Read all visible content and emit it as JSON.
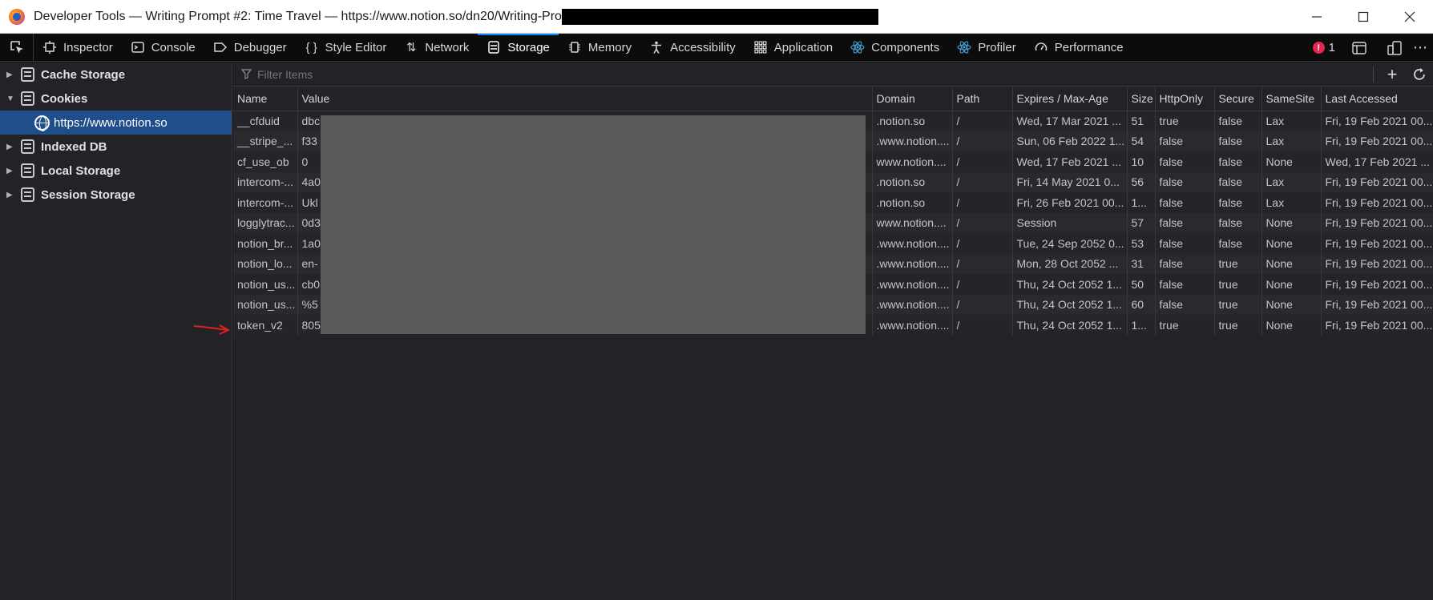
{
  "window": {
    "title": "Developer Tools — Writing Prompt #2: Time Travel — https://www.notion.so/dn20/Writing-Pro",
    "controls": [
      "minimize",
      "maximize",
      "close"
    ]
  },
  "toolbar": {
    "tabs": [
      {
        "label": "Inspector",
        "icon": "inspector-icon"
      },
      {
        "label": "Console",
        "icon": "console-icon"
      },
      {
        "label": "Debugger",
        "icon": "debugger-icon"
      },
      {
        "label": "Style Editor",
        "icon": "style-editor-icon"
      },
      {
        "label": "Network",
        "icon": "network-icon"
      },
      {
        "label": "Storage",
        "icon": "storage-icon",
        "active": true
      },
      {
        "label": "Memory",
        "icon": "memory-icon"
      },
      {
        "label": "Accessibility",
        "icon": "accessibility-icon"
      },
      {
        "label": "Application",
        "icon": "application-icon"
      },
      {
        "label": "Components",
        "icon": "react-icon"
      },
      {
        "label": "Profiler",
        "icon": "react-icon"
      },
      {
        "label": "Performance",
        "icon": "performance-icon"
      }
    ],
    "error_count": "1"
  },
  "sidebar": {
    "items": [
      {
        "label": "Cache Storage",
        "expanded": false
      },
      {
        "label": "Cookies",
        "expanded": true
      },
      {
        "label": "Indexed DB",
        "expanded": false
      },
      {
        "label": "Local Storage",
        "expanded": false
      },
      {
        "label": "Session Storage",
        "expanded": false
      }
    ],
    "cookies_child": "https://www.notion.so"
  },
  "filter": {
    "placeholder": "Filter Items"
  },
  "table": {
    "columns": [
      "Name",
      "Value",
      "Domain",
      "Path",
      "Expires / Max-Age",
      "Size",
      "HttpOnly",
      "Secure",
      "SameSite",
      "Last Accessed"
    ],
    "rows": [
      [
        "__cfduid",
        "dbc",
        ".notion.so",
        "/",
        "Wed, 17 Mar 2021 ...",
        "51",
        "true",
        "false",
        "Lax",
        "Fri, 19 Feb 2021 00..."
      ],
      [
        "__stripe_...",
        "f33",
        ".www.notion....",
        "/",
        "Sun, 06 Feb 2022 1...",
        "54",
        "false",
        "false",
        "Lax",
        "Fri, 19 Feb 2021 00..."
      ],
      [
        "cf_use_ob",
        "0",
        "www.notion....",
        "/",
        "Wed, 17 Feb 2021 ...",
        "10",
        "false",
        "false",
        "None",
        "Wed, 17 Feb 2021 ..."
      ],
      [
        "intercom-...",
        "4a0",
        ".notion.so",
        "/",
        "Fri, 14 May 2021 0...",
        "56",
        "false",
        "false",
        "Lax",
        "Fri, 19 Feb 2021 00..."
      ],
      [
        "intercom-...",
        "Ukl",
        ".notion.so",
        "/",
        "Fri, 26 Feb 2021 00...",
        "1...",
        "false",
        "false",
        "Lax",
        "Fri, 19 Feb 2021 00..."
      ],
      [
        "logglytrac...",
        "0d3",
        "www.notion....",
        "/",
        "Session",
        "57",
        "false",
        "false",
        "None",
        "Fri, 19 Feb 2021 00..."
      ],
      [
        "notion_br...",
        "1a0",
        ".www.notion....",
        "/",
        "Tue, 24 Sep 2052 0...",
        "53",
        "false",
        "false",
        "None",
        "Fri, 19 Feb 2021 00..."
      ],
      [
        "notion_lo...",
        "en-",
        ".www.notion....",
        "/",
        "Mon, 28 Oct 2052 ...",
        "31",
        "false",
        "true",
        "None",
        "Fri, 19 Feb 2021 00..."
      ],
      [
        "notion_us...",
        "cb0",
        ".www.notion....",
        "/",
        "Thu, 24 Oct 2052 1...",
        "50",
        "false",
        "true",
        "None",
        "Fri, 19 Feb 2021 00..."
      ],
      [
        "notion_us...",
        "%5",
        ".www.notion....",
        "/",
        "Thu, 24 Oct 2052 1...",
        "60",
        "false",
        "true",
        "None",
        "Fri, 19 Feb 2021 00..."
      ],
      [
        "token_v2",
        "805",
        ".www.notion....",
        "/",
        "Thu, 24 Oct 2052 1...",
        "1...",
        "true",
        "true",
        "None",
        "Fri, 19 Feb 2021 00..."
      ]
    ]
  },
  "colors": {
    "accent": "#0a84ff",
    "selected_row": "#204e8a",
    "annotation_arrow": "#e02020"
  }
}
